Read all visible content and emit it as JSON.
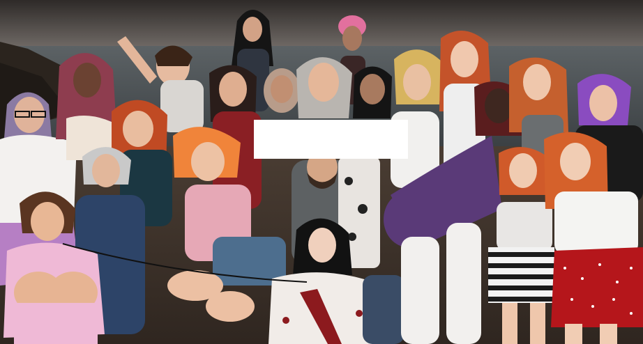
{
  "scene": {
    "kind": "rendered group portrait on a beach at dusk",
    "colors": {
      "sky_top": "#3a3532",
      "sky_horizon": "#6f6a66",
      "sea": "#4d5457",
      "sand": "#5a4a3e",
      "rocks": "#2b241e",
      "censor_box": "#ffffff"
    }
  }
}
